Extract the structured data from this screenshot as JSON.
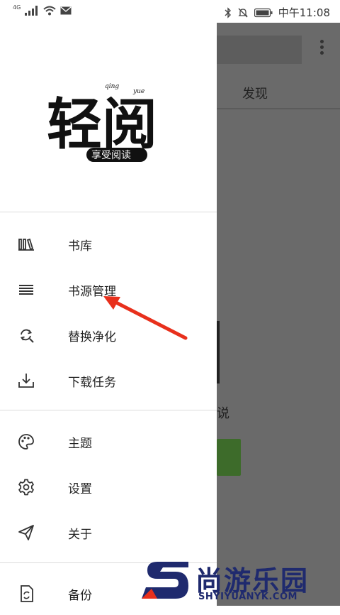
{
  "status_bar": {
    "network": "4G",
    "time": "中午11:08"
  },
  "background_app": {
    "tab_label": "发现",
    "partial_text": "说"
  },
  "drawer": {
    "logo": {
      "title": "轻阅",
      "subtitle": "享受阅读",
      "pinyin_left": "qing",
      "pinyin_right": "yue"
    },
    "menu_section_1": [
      {
        "label": "书库",
        "icon": "bookshelf-icon"
      },
      {
        "label": "书源管理",
        "icon": "list-icon"
      },
      {
        "label": "替换净化",
        "icon": "replace-icon"
      },
      {
        "label": "下载任务",
        "icon": "download-icon"
      }
    ],
    "menu_section_2": [
      {
        "label": "主题",
        "icon": "palette-icon"
      },
      {
        "label": "设置",
        "icon": "gear-icon"
      },
      {
        "label": "关于",
        "icon": "send-icon"
      }
    ],
    "menu_section_3": [
      {
        "label": "备份",
        "icon": "backup-icon"
      }
    ]
  },
  "watermark": {
    "cn": "尚游乐园",
    "en": "SHYIYUANYK.COM"
  },
  "colors": {
    "annotation_arrow": "#e8301c",
    "watermark_blue": "#1f2a6e",
    "overlay": "#6a6a6a"
  }
}
